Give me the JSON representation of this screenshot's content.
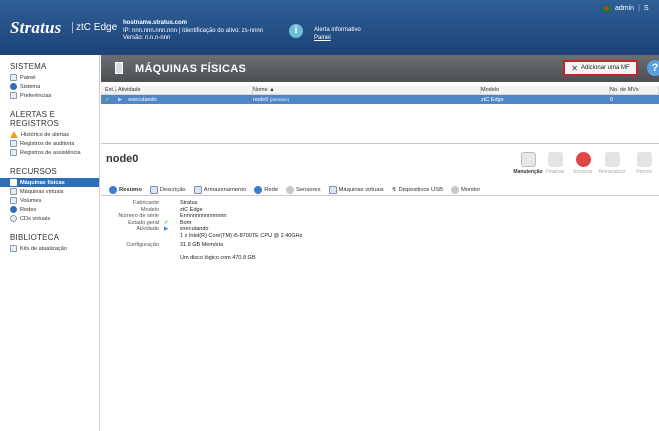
{
  "header": {
    "logo": "Stratus",
    "product": "ztC Edge",
    "host_name": "hostname.stratus.com",
    "host_line2": "IP: nnn.nnn.nnn.nnn | Identificação do ativo: zs-nnnn",
    "host_line3": "Versão: n.n.n-nnn",
    "alert_title": "Alerta informativo",
    "alert_link": "Painel",
    "user": "admin",
    "separator": "|",
    "overflow": "S"
  },
  "sidebar": {
    "sections": [
      {
        "title": "SISTEMA",
        "items": [
          "Painel",
          "Sistema",
          "Preferências"
        ]
      },
      {
        "title": "ALERTAS E REGISTROS",
        "items": [
          "Histórico de alertas",
          "Registros de auditoria",
          "Registros de assistência"
        ]
      },
      {
        "title": "RECURSOS",
        "items": [
          "Máquinas físicas",
          "Máquinas virtuais",
          "Volumes",
          "Redes",
          "CDs virtuais"
        ]
      },
      {
        "title": "BIBLIOTECA",
        "items": [
          "Kits de atualização"
        ]
      }
    ]
  },
  "page": {
    "title": "MÁQUINAS FÍSICAS",
    "add_button": "Adicionar uma MF",
    "help": "?"
  },
  "table": {
    "headers": {
      "state": "Est...",
      "activity": "Atividade",
      "name": "Nome ▲",
      "model": "Modelo",
      "vms": "No. de MVs"
    },
    "row": {
      "activity": "executando",
      "name": "node0",
      "name_tag": "(primário)",
      "model": "ztC Edge",
      "vms": "0"
    }
  },
  "detail": {
    "title": "node0",
    "actions": [
      "Manutenção",
      "Finalizar",
      "Encerrar",
      "Reinicializar",
      "Remov"
    ],
    "tabs": [
      "Resumo",
      "Descrição",
      "Armazenamento",
      "Rede",
      "Sensores",
      "Máquinas virtuais",
      "Dispositivos USB",
      "Monitor"
    ],
    "props": {
      "fabricante_label": "Fabricante",
      "fabricante": "Stratus",
      "modelo_label": "Modelo",
      "modelo": "ztC Edge",
      "serie_label": "Número de série",
      "serie": "Ennnnnnnnnnnnnn",
      "estado_label": "Estado geral",
      "estado": "Bom",
      "atividade_label": "Atividade",
      "atividade": "executando",
      "cpu": "1 x Intel(R) Core(TM) i5-8700TE CPU @ 2.40GHz",
      "config_label": "Configuração",
      "memoria": "31.9 GB Memória",
      "disco": "Um disco lógico com 470.8 GB"
    }
  }
}
